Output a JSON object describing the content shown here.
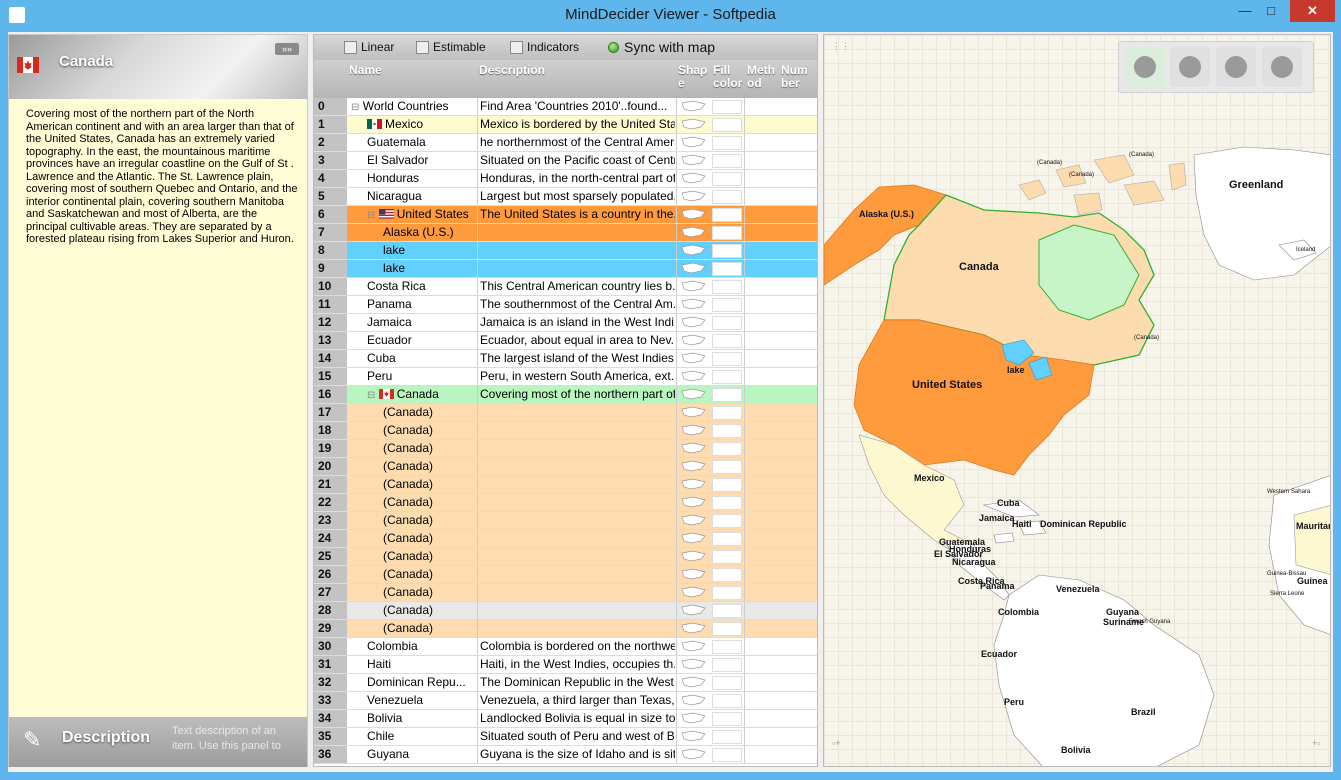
{
  "window": {
    "title": "MindDecider Viewer - Softpedia",
    "minimize": "—",
    "maximize": "□",
    "close": "✕"
  },
  "left_panel": {
    "header_title": "Canada",
    "close_label": "»»",
    "text": "Covering most of the northern part of the North American continent and with an area larger than that of the United States, Canada has an extremely varied topography. In the east, the mountainous maritime provinces have an irregular coastline on the Gulf of St . Lawrence and the Atlantic. The St. Lawrence plain, covering most of southern Quebec and Ontario, and the interior continental plain, covering southern Manitoba and Saskatchewan and most of Alberta, are the principal cultivable areas. They are separated by a forested plateau rising from Lakes Superior and Huron.",
    "footer_label": "Description",
    "footer_hint": "Text description of an item. Use this panel to"
  },
  "toolbar": {
    "linear": "Linear",
    "estimable": "Estimable",
    "indicators": "Indicators",
    "sync": "Sync with map"
  },
  "columns": {
    "name": "Name",
    "description": "Description",
    "shape": "Shap e",
    "fill_color": "Fill color",
    "method": "Meth od",
    "number": "Num ber"
  },
  "rows": [
    {
      "n": "0",
      "name": "World Countries",
      "desc": "Find Area 'Countries 2010'..found...",
      "level": 0,
      "bg": "#ffffff",
      "flag": "",
      "tree": "⊟"
    },
    {
      "n": "1",
      "name": "Mexico",
      "desc": "Mexico is bordered by the United Sta...",
      "level": 1,
      "bg": "#fffbd0",
      "flag": "mx",
      "tree": ""
    },
    {
      "n": "2",
      "name": "Guatemala",
      "desc": "he northernmost of the Central Ameri...",
      "level": 1,
      "bg": "#ffffff",
      "flag": "",
      "tree": ""
    },
    {
      "n": "3",
      "name": "El Salvador",
      "desc": "Situated on the Pacific coast of Centr...",
      "level": 1,
      "bg": "#ffffff",
      "flag": "",
      "tree": ""
    },
    {
      "n": "4",
      "name": "Honduras",
      "desc": "Honduras, in the north-central part of...",
      "level": 1,
      "bg": "#ffffff",
      "flag": "",
      "tree": ""
    },
    {
      "n": "5",
      "name": "Nicaragua",
      "desc": "Largest but most sparsely populated...",
      "level": 1,
      "bg": "#ffffff",
      "flag": "",
      "tree": ""
    },
    {
      "n": "6",
      "name": "United States",
      "desc": "The United States is a country in the...",
      "level": 1,
      "bg": "#ff9a3d",
      "flag": "us",
      "tree": "⊟"
    },
    {
      "n": "7",
      "name": "Alaska (U.S.)",
      "desc": "",
      "level": 2,
      "bg": "#ff9a3d",
      "flag": "",
      "tree": ""
    },
    {
      "n": "8",
      "name": "lake",
      "desc": "",
      "level": 2,
      "bg": "#62d0ff",
      "flag": "",
      "tree": ""
    },
    {
      "n": "9",
      "name": "lake",
      "desc": "",
      "level": 2,
      "bg": "#62d0ff",
      "flag": "",
      "tree": ""
    },
    {
      "n": "10",
      "name": "Costa Rica",
      "desc": "This Central American country lies b...",
      "level": 1,
      "bg": "#ffffff",
      "flag": "",
      "tree": ""
    },
    {
      "n": "11",
      "name": "Panama",
      "desc": "The southernmost of the Central Am...",
      "level": 1,
      "bg": "#ffffff",
      "flag": "",
      "tree": ""
    },
    {
      "n": "12",
      "name": "Jamaica",
      "desc": "Jamaica is an island in the West Indi...",
      "level": 1,
      "bg": "#ffffff",
      "flag": "",
      "tree": ""
    },
    {
      "n": "13",
      "name": "Ecuador",
      "desc": "Ecuador, about equal in area to Nev...",
      "level": 1,
      "bg": "#ffffff",
      "flag": "",
      "tree": ""
    },
    {
      "n": "14",
      "name": "Cuba",
      "desc": "The largest island of the West Indies...",
      "level": 1,
      "bg": "#ffffff",
      "flag": "",
      "tree": ""
    },
    {
      "n": "15",
      "name": "Peru",
      "desc": "Peru, in western South America, ext...",
      "level": 1,
      "bg": "#ffffff",
      "flag": "",
      "tree": ""
    },
    {
      "n": "16",
      "name": "Canada",
      "desc": "Covering most of the northern part of...",
      "level": 1,
      "bg": "#b9f5bf",
      "flag": "ca",
      "tree": "⊟"
    },
    {
      "n": "17",
      "name": "(Canada)",
      "desc": "",
      "level": 2,
      "bg": "#ffdcb0",
      "flag": "",
      "tree": ""
    },
    {
      "n": "18",
      "name": "(Canada)",
      "desc": "",
      "level": 2,
      "bg": "#ffdcb0",
      "flag": "",
      "tree": ""
    },
    {
      "n": "19",
      "name": "(Canada)",
      "desc": "",
      "level": 2,
      "bg": "#ffdcb0",
      "flag": "",
      "tree": ""
    },
    {
      "n": "20",
      "name": "(Canada)",
      "desc": "",
      "level": 2,
      "bg": "#ffdcb0",
      "flag": "",
      "tree": ""
    },
    {
      "n": "21",
      "name": "(Canada)",
      "desc": "",
      "level": 2,
      "bg": "#ffdcb0",
      "flag": "",
      "tree": ""
    },
    {
      "n": "22",
      "name": "(Canada)",
      "desc": "",
      "level": 2,
      "bg": "#ffdcb0",
      "flag": "",
      "tree": ""
    },
    {
      "n": "23",
      "name": "(Canada)",
      "desc": "",
      "level": 2,
      "bg": "#ffdcb0",
      "flag": "",
      "tree": ""
    },
    {
      "n": "24",
      "name": "(Canada)",
      "desc": "",
      "level": 2,
      "bg": "#ffdcb0",
      "flag": "",
      "tree": ""
    },
    {
      "n": "25",
      "name": "(Canada)",
      "desc": "",
      "level": 2,
      "bg": "#ffdcb0",
      "flag": "",
      "tree": ""
    },
    {
      "n": "26",
      "name": "(Canada)",
      "desc": "",
      "level": 2,
      "bg": "#ffdcb0",
      "flag": "",
      "tree": ""
    },
    {
      "n": "27",
      "name": "(Canada)",
      "desc": "",
      "level": 2,
      "bg": "#ffdcb0",
      "flag": "",
      "tree": ""
    },
    {
      "n": "28",
      "name": "(Canada)",
      "desc": "",
      "level": 2,
      "bg": "#e8e8e8",
      "flag": "",
      "tree": ""
    },
    {
      "n": "29",
      "name": "(Canada)",
      "desc": "",
      "level": 2,
      "bg": "#ffdcb0",
      "flag": "",
      "tree": ""
    },
    {
      "n": "30",
      "name": "Colombia",
      "desc": "Colombia is bordered on the northwe...",
      "level": 1,
      "bg": "#ffffff",
      "flag": "",
      "tree": ""
    },
    {
      "n": "31",
      "name": "Haiti",
      "desc": "Haiti, in the West Indies, occupies th...",
      "level": 1,
      "bg": "#ffffff",
      "flag": "",
      "tree": ""
    },
    {
      "n": "32",
      "name": "Dominican Repu...",
      "desc": "The Dominican Republic in the West...",
      "level": 1,
      "bg": "#ffffff",
      "flag": "",
      "tree": ""
    },
    {
      "n": "33",
      "name": "Venezuela",
      "desc": "Venezuela, a third larger than Texas,...",
      "level": 1,
      "bg": "#ffffff",
      "flag": "",
      "tree": ""
    },
    {
      "n": "34",
      "name": "Bolivia",
      "desc": "Landlocked Bolivia is equal in size to...",
      "level": 1,
      "bg": "#ffffff",
      "flag": "",
      "tree": ""
    },
    {
      "n": "35",
      "name": "Chile",
      "desc": "Situated south of Peru and west of B...",
      "level": 1,
      "bg": "#ffffff",
      "flag": "",
      "tree": ""
    },
    {
      "n": "36",
      "name": "Guyana",
      "desc": "Guyana is the size of Idaho and is sit...",
      "level": 1,
      "bg": "#ffffff",
      "flag": "",
      "tree": ""
    }
  ],
  "map": {
    "labels": {
      "greenland": "Greenland",
      "alaska": "Alaska (U.S.)",
      "canada": "Canada",
      "usa": "United States",
      "lake": "lake",
      "mexico": "Mexico",
      "cuba": "Cuba",
      "jamaica": "Jamaica",
      "haiti": "Haiti",
      "dominican": "Dominican Republic",
      "guatemala": "Guatemala",
      "el_salvador": "El Salvador",
      "honduras": "Honduras",
      "nicaragua": "Nicaragua",
      "costa_rica": "Costa Rica",
      "panama": "Panama",
      "venezuela": "Venezuela",
      "guyana": "Guyana",
      "suriname": "Suriname",
      "french_guyana": "French Guyana",
      "colombia": "Colombia",
      "ecuador": "Ecuador",
      "peru": "Peru",
      "brazil": "Brazil",
      "bolivia": "Bolivia",
      "iceland": "Iceland",
      "mauritania": "Mauritania",
      "western_sahara": "Western Sahara",
      "guinea_bissau": "Guinea-Bissau",
      "guinea": "Guinea",
      "sierra_leone": "Sierra Leone",
      "canada_small": "(Canada)"
    }
  },
  "colors": {
    "orange": "#ff9a3d",
    "canada_fill": "#fcdcae",
    "green": "#c8f5c8",
    "lake": "#62d0ff",
    "mexico_fill": "#fdf8d0"
  }
}
